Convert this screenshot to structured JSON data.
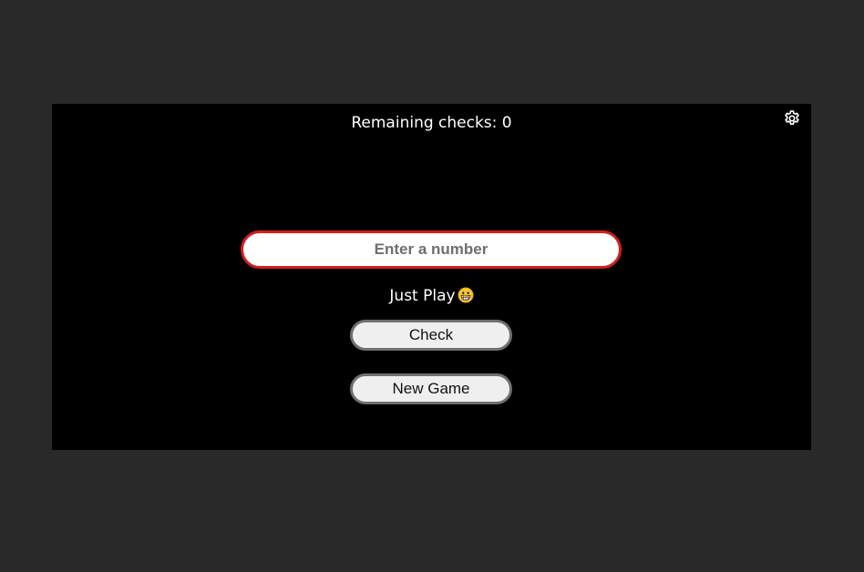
{
  "header": {
    "remaining_label": "Remaining checks: ",
    "remaining_count": "0",
    "settings_icon": "gear-icon"
  },
  "input": {
    "placeholder": "Enter a number",
    "value": ""
  },
  "status": {
    "message": "Just Play",
    "emoji_icon": "grinning-face-icon"
  },
  "buttons": {
    "check_label": "Check",
    "new_game_label": "New Game"
  },
  "colors": {
    "page_background": "#2a2929",
    "panel_background": "#000000",
    "input_border": "#d51d1d",
    "button_background": "#efefef",
    "button_border": "#6f6f6f",
    "text": "#ffffff"
  }
}
